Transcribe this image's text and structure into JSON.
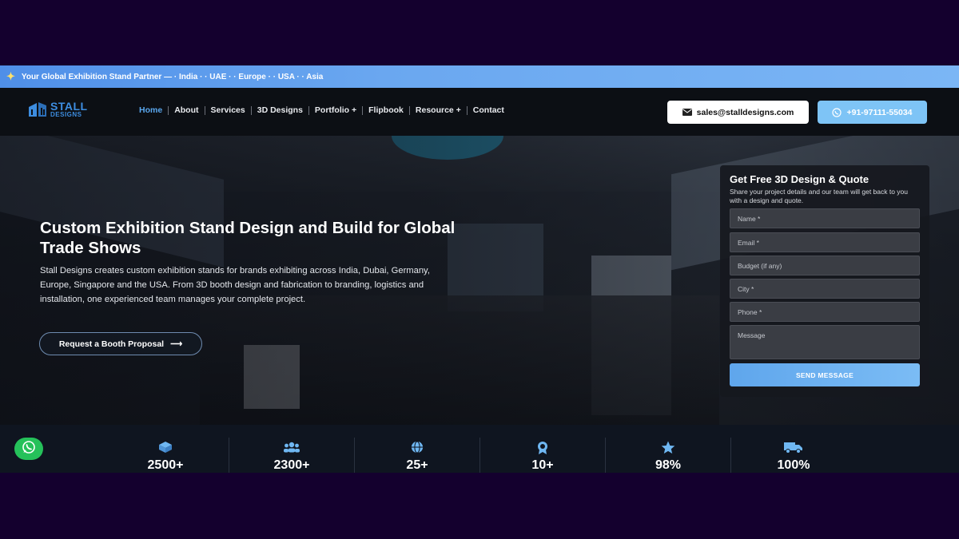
{
  "topbar": {
    "text": "Your Global Exhibition Stand Partner —  · India · · UAE · · Europe · · USA · · Asia"
  },
  "logo": {
    "line1": "STALL",
    "line2": "DESIGNS"
  },
  "nav": {
    "items": [
      "Home",
      "About",
      "Services",
      "3D Designs",
      "Portfolio +",
      "Flipbook",
      "Resource +",
      "Contact"
    ],
    "active": "Home"
  },
  "header_buttons": {
    "email": "sales@stalldesigns.com",
    "phone": "+91-97111-55034"
  },
  "hero": {
    "title": "Custom Exhibition Stand Design and Build for Global Trade Shows",
    "description": "Stall Designs creates custom exhibition stands for brands exhibiting across India, Dubai, Germany, Europe, Singapore and the USA. From 3D booth design and fabrication to branding, logistics and installation, one experienced team manages your complete project.",
    "cta": "Request a Booth Proposal"
  },
  "quote_form": {
    "title": "Get Free 3D Design & Quote",
    "subtitle": "Share your project details and our team will get back to you with a design and quote.",
    "fields": {
      "name": "Name *",
      "email": "Email *",
      "budget": "Budget (if any)",
      "city": "City *",
      "phone": "Phone *",
      "message": "Message"
    },
    "submit": "SEND MESSAGE"
  },
  "stats": [
    {
      "icon": "cube-icon",
      "value": "2500+"
    },
    {
      "icon": "users-icon",
      "value": "2300+"
    },
    {
      "icon": "globe-icon",
      "value": "25+"
    },
    {
      "icon": "award-icon",
      "value": "10+"
    },
    {
      "icon": "star-icon",
      "value": "98%"
    },
    {
      "icon": "truck-icon",
      "value": "100%"
    }
  ],
  "colors": {
    "accent": "#5aa7ee",
    "topbar": "#6aa7f0",
    "whatsapp": "#25c15a",
    "page_bg": "#14002e"
  }
}
